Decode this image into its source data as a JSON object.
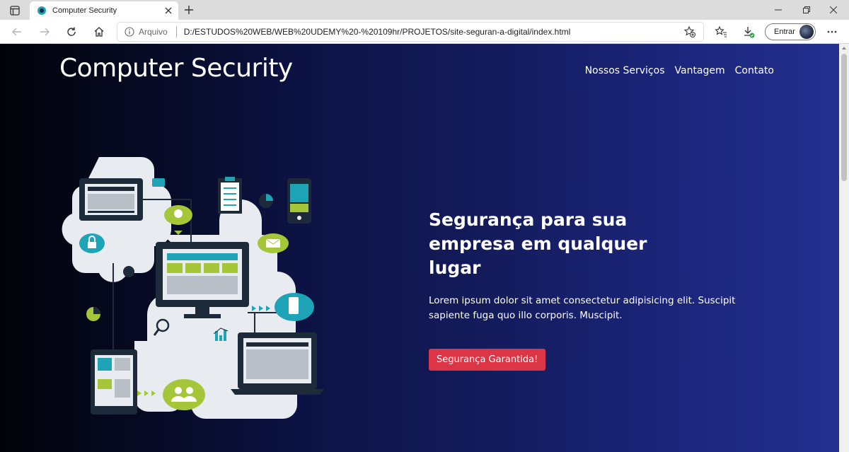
{
  "browser": {
    "tab": {
      "title": "Computer Security",
      "close_icon": "close-icon"
    },
    "address": {
      "info_label": "Arquivo",
      "url": "D:/ESTUDOS%20WEB/WEB%20UDEMY%20-%20109hr/PROJETOS/site-seguran-a-digital/index.html"
    },
    "signin_label": "Entrar"
  },
  "page": {
    "brand": "Computer Security",
    "nav": [
      "Nossos Serviços",
      "Vantagem",
      "Contato"
    ],
    "hero": {
      "title": "Segurança para sua empresa em qualquer lugar",
      "text": "Lorem ipsum dolor sit amet consectetur adipisicing elit. Suscipit sapiente fuga quo illo corporis. Muscipit.",
      "cta": "Segurança Garantida!"
    },
    "colors": {
      "cta": "#dc3545",
      "accent_teal": "#1fa3b6",
      "accent_green": "#a6c63a",
      "gear": "#e8ecf0",
      "dark_device": "#1c2a3a"
    }
  }
}
